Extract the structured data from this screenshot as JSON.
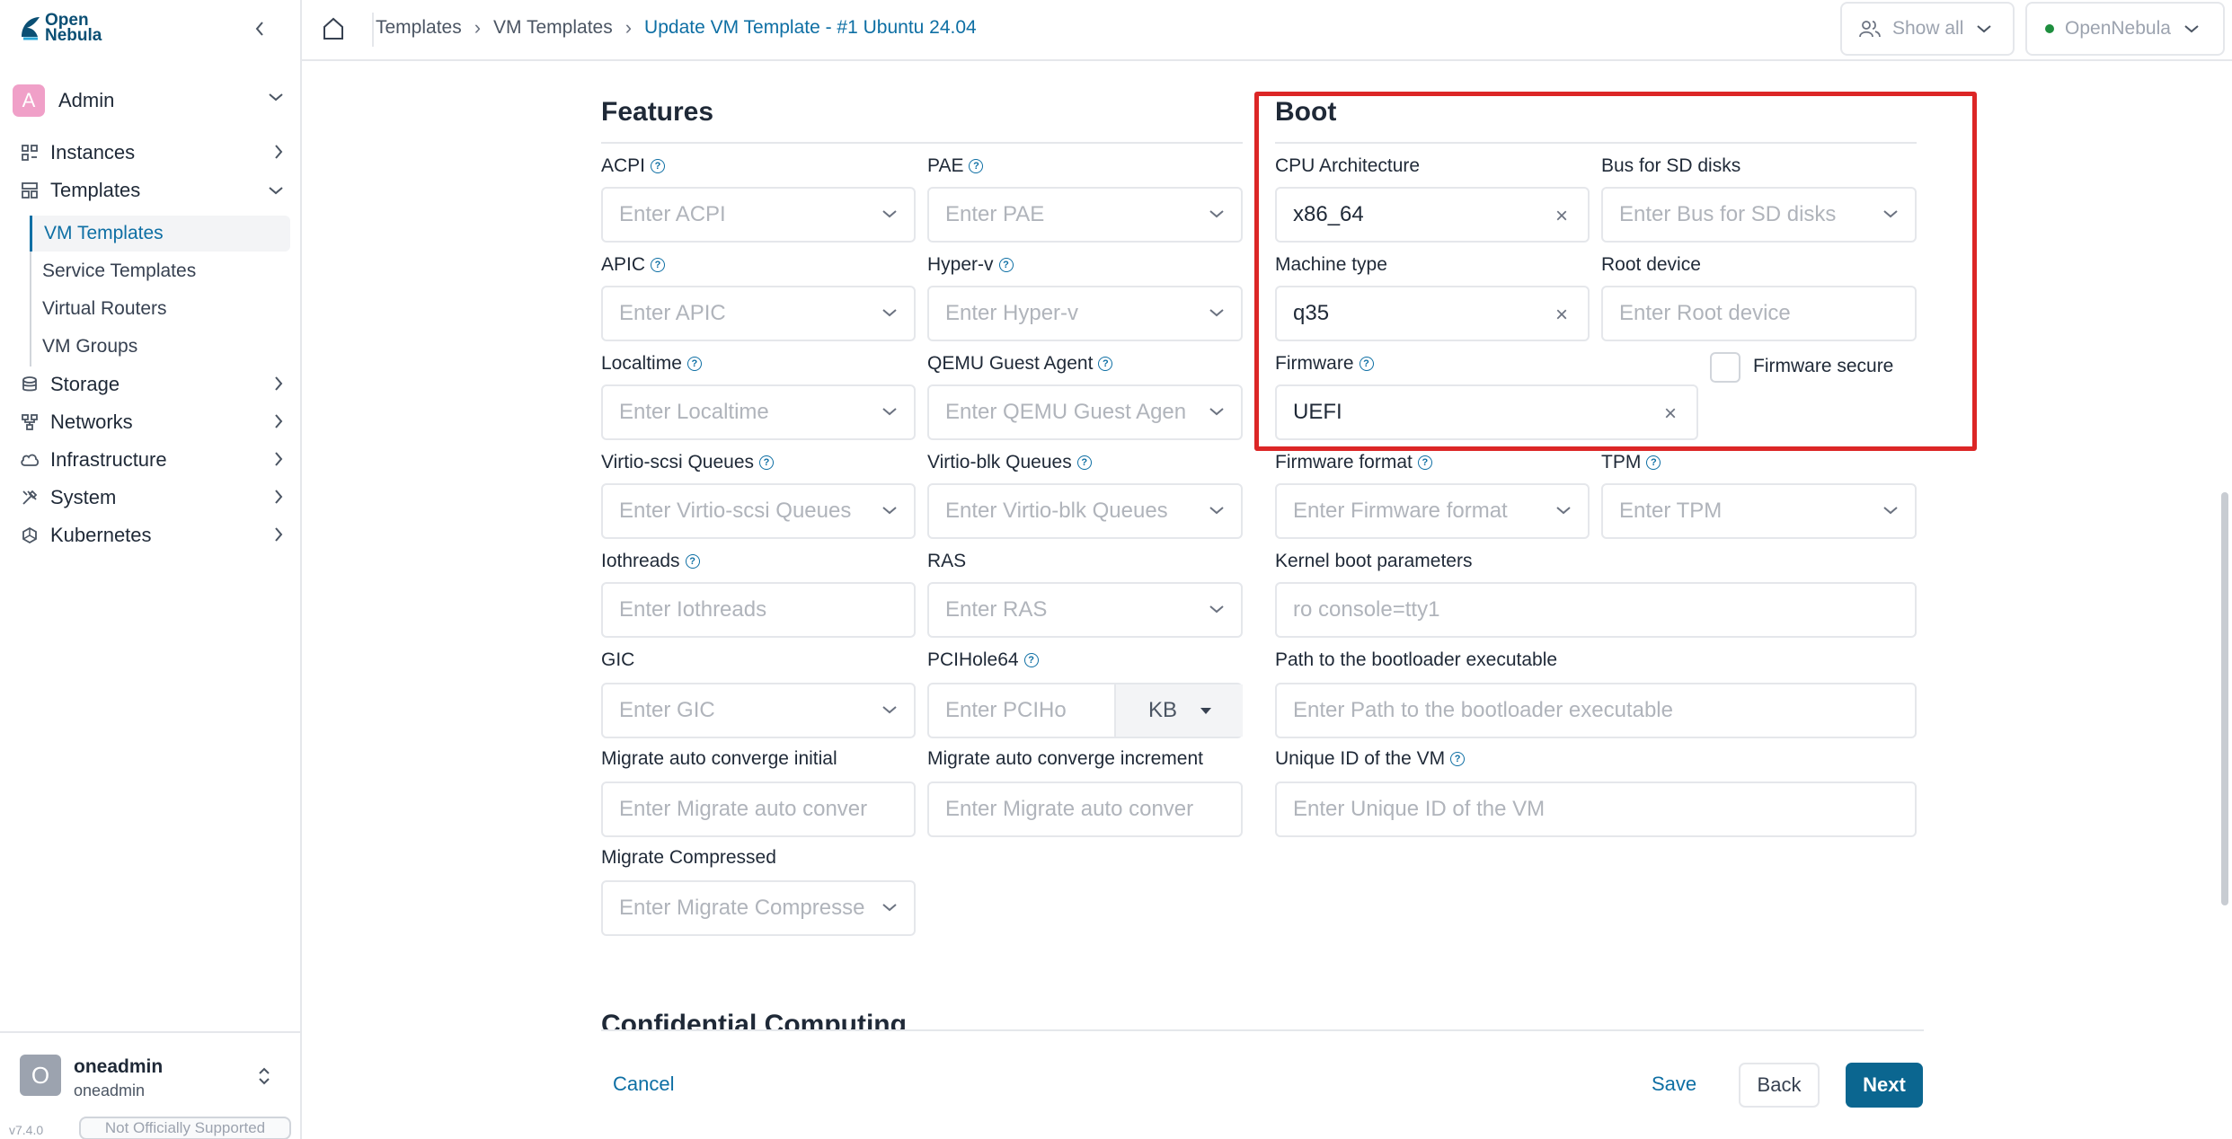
{
  "app": {
    "logo_text_line1": "Open",
    "logo_text_line2": "Nebula",
    "version": "v7.4.0",
    "support_badge": "Not Officially Supported"
  },
  "sidebar": {
    "group": {
      "avatar_letter": "A",
      "label": "Admin"
    },
    "items": [
      {
        "label": "Instances",
        "icon": "instances-icon"
      },
      {
        "label": "Templates",
        "icon": "templates-icon",
        "expanded": true
      },
      {
        "label": "Storage",
        "icon": "storage-icon"
      },
      {
        "label": "Networks",
        "icon": "networks-icon"
      },
      {
        "label": "Infrastructure",
        "icon": "cloud-icon"
      },
      {
        "label": "System",
        "icon": "system-icon"
      },
      {
        "label": "Kubernetes",
        "icon": "kubernetes-icon"
      }
    ],
    "sub_items": [
      {
        "label": "VM Templates",
        "active": true
      },
      {
        "label": "Service Templates"
      },
      {
        "label": "Virtual Routers"
      },
      {
        "label": "VM Groups"
      }
    ],
    "user": {
      "avatar_letter": "O",
      "name": "oneadmin",
      "group": "oneadmin"
    }
  },
  "header": {
    "breadcrumb": [
      "Templates",
      "VM Templates",
      "Update VM Template - #1 Ubuntu 24.04"
    ],
    "view_filter": "Show all",
    "zone": "OpenNebula",
    "zone_status_color": "#1e8e3e"
  },
  "features": {
    "title": "Features",
    "fields": {
      "acpi": {
        "label": "ACPI",
        "placeholder": "Enter ACPI"
      },
      "pae": {
        "label": "PAE",
        "placeholder": "Enter PAE"
      },
      "apic": {
        "label": "APIC",
        "placeholder": "Enter APIC"
      },
      "hyperv": {
        "label": "Hyper-v",
        "placeholder": "Enter Hyper-v"
      },
      "localtime": {
        "label": "Localtime",
        "placeholder": "Enter Localtime"
      },
      "qemu_agent": {
        "label": "QEMU Guest Agent",
        "placeholder": "Enter QEMU Guest Agen"
      },
      "virtio_scsi": {
        "label": "Virtio-scsi Queues",
        "placeholder": "Enter Virtio-scsi Queues"
      },
      "virtio_blk": {
        "label": "Virtio-blk Queues",
        "placeholder": "Enter Virtio-blk Queues"
      },
      "iothreads": {
        "label": "Iothreads",
        "placeholder": "Enter Iothreads"
      },
      "ras": {
        "label": "RAS",
        "placeholder": "Enter RAS"
      },
      "gic": {
        "label": "GIC",
        "placeholder": "Enter GIC"
      },
      "pcihole64": {
        "label": "PCIHole64",
        "placeholder": "Enter PCIHo",
        "unit": "KB"
      },
      "migrate_initial": {
        "label": "Migrate auto converge initial",
        "placeholder": "Enter Migrate auto conver"
      },
      "migrate_increment": {
        "label": "Migrate auto converge increment",
        "placeholder": "Enter Migrate auto conver"
      },
      "migrate_compressed": {
        "label": "Migrate Compressed",
        "placeholder": "Enter Migrate Compressе"
      }
    }
  },
  "boot": {
    "title": "Boot",
    "fields": {
      "cpu_arch": {
        "label": "CPU Architecture",
        "value": "x86_64"
      },
      "sd_bus": {
        "label": "Bus for SD disks",
        "placeholder": "Enter Bus for SD disks"
      },
      "machine_type": {
        "label": "Machine type",
        "value": "q35"
      },
      "root_device": {
        "label": "Root device",
        "placeholder": "Enter Root device"
      },
      "firmware": {
        "label": "Firmware",
        "value": "UEFI"
      },
      "firmware_secure": {
        "label": "Firmware secure",
        "checked": false
      },
      "firmware_format": {
        "label": "Firmware format",
        "placeholder": "Enter Firmware format"
      },
      "tpm": {
        "label": "TPM",
        "placeholder": "Enter TPM"
      },
      "kernel_params": {
        "label": "Kernel boot parameters",
        "placeholder": "ro console=tty1"
      },
      "bootloader": {
        "label": "Path to the bootloader executable",
        "placeholder": "Enter Path to the bootloader executable"
      },
      "uuid": {
        "label": "Unique ID of the VM",
        "placeholder": "Enter Unique ID of the VM"
      }
    }
  },
  "next_section": {
    "title": "Confidential Computing"
  },
  "footer": {
    "cancel": "Cancel",
    "save": "Save",
    "back": "Back",
    "next": "Next"
  },
  "colors": {
    "accent": "#0e6fa4",
    "primary_button": "#0b6690",
    "highlight": "#dc2626"
  }
}
